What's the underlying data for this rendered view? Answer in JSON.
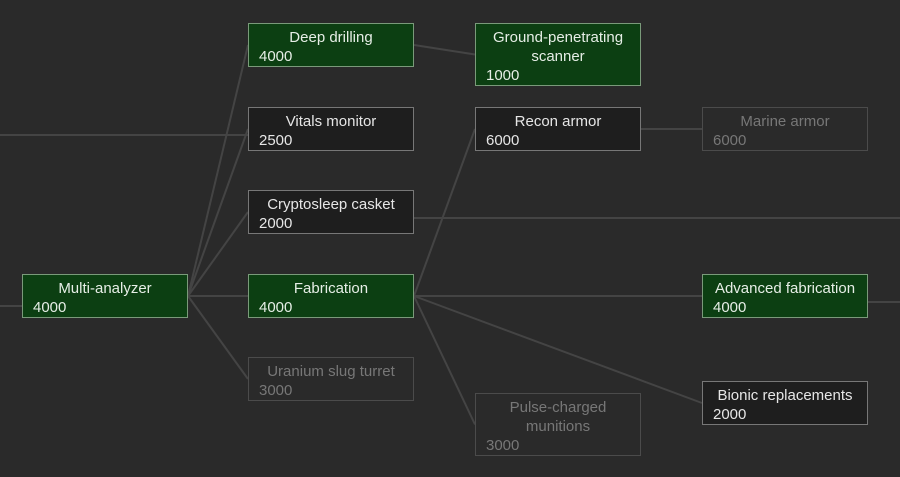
{
  "colors": {
    "background": "#2a2a2a",
    "link": "#444444",
    "completed": "#0c3f12",
    "available": "#1e1e1e"
  },
  "nodes": [
    {
      "id": "multi-analyzer",
      "name": "Multi-analyzer",
      "cost": "4000",
      "state": "completed"
    },
    {
      "id": "deep-drilling",
      "name": "Deep drilling",
      "cost": "4000",
      "state": "completed"
    },
    {
      "id": "vitals-monitor",
      "name": "Vitals monitor",
      "cost": "2500",
      "state": "available"
    },
    {
      "id": "cryptosleep-casket",
      "name": "Cryptosleep casket",
      "cost": "2000",
      "state": "available"
    },
    {
      "id": "fabrication",
      "name": "Fabrication",
      "cost": "4000",
      "state": "completed"
    },
    {
      "id": "uranium-slug-turret",
      "name": "Uranium slug turret",
      "cost": "3000",
      "state": "locked"
    },
    {
      "id": "ground-penetrating-scanner",
      "name": "Ground-penetrating scanner",
      "cost": "1000",
      "state": "completed"
    },
    {
      "id": "recon-armor",
      "name": "Recon armor",
      "cost": "6000",
      "state": "available"
    },
    {
      "id": "pulse-charged-munitions",
      "name": "Pulse-charged munitions",
      "cost": "3000",
      "state": "locked"
    },
    {
      "id": "marine-armor",
      "name": "Marine armor",
      "cost": "6000",
      "state": "locked"
    },
    {
      "id": "advanced-fabrication",
      "name": "Advanced fabrication",
      "cost": "4000",
      "state": "completed"
    },
    {
      "id": "bionic-replacements",
      "name": "Bionic replacements",
      "cost": "2000",
      "state": "available"
    }
  ],
  "links": [
    {
      "from": "multi-analyzer",
      "to": "deep-drilling"
    },
    {
      "from": "multi-analyzer",
      "to": "vitals-monitor"
    },
    {
      "from": "multi-analyzer",
      "to": "cryptosleep-casket"
    },
    {
      "from": "multi-analyzer",
      "to": "fabrication"
    },
    {
      "from": "multi-analyzer",
      "to": "uranium-slug-turret"
    },
    {
      "from": "deep-drilling",
      "to": "ground-penetrating-scanner"
    },
    {
      "from": "fabrication",
      "to": "recon-armor"
    },
    {
      "from": "fabrication",
      "to": "advanced-fabrication"
    },
    {
      "from": "fabrication",
      "to": "pulse-charged-munitions"
    },
    {
      "from": "fabrication",
      "to": "bionic-replacements"
    },
    {
      "from": "recon-armor",
      "to": "marine-armor"
    }
  ]
}
